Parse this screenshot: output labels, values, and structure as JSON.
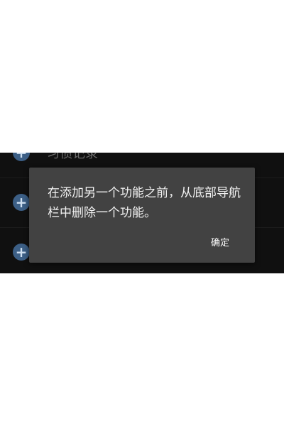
{
  "list": {
    "items": [
      {
        "icon": "add-icon",
        "label": "习惯记录"
      },
      {
        "icon": "add-icon",
        "label": ""
      },
      {
        "icon": "add-icon",
        "label": ""
      }
    ]
  },
  "dialog": {
    "message": "在添加另一个功能之前，从底部导航栏中删除一个功能。",
    "confirm_label": "确定"
  },
  "colors": {
    "dialog_bg": "#424242",
    "icon_accent": "#3c5f86",
    "list_bg": "#101010"
  }
}
